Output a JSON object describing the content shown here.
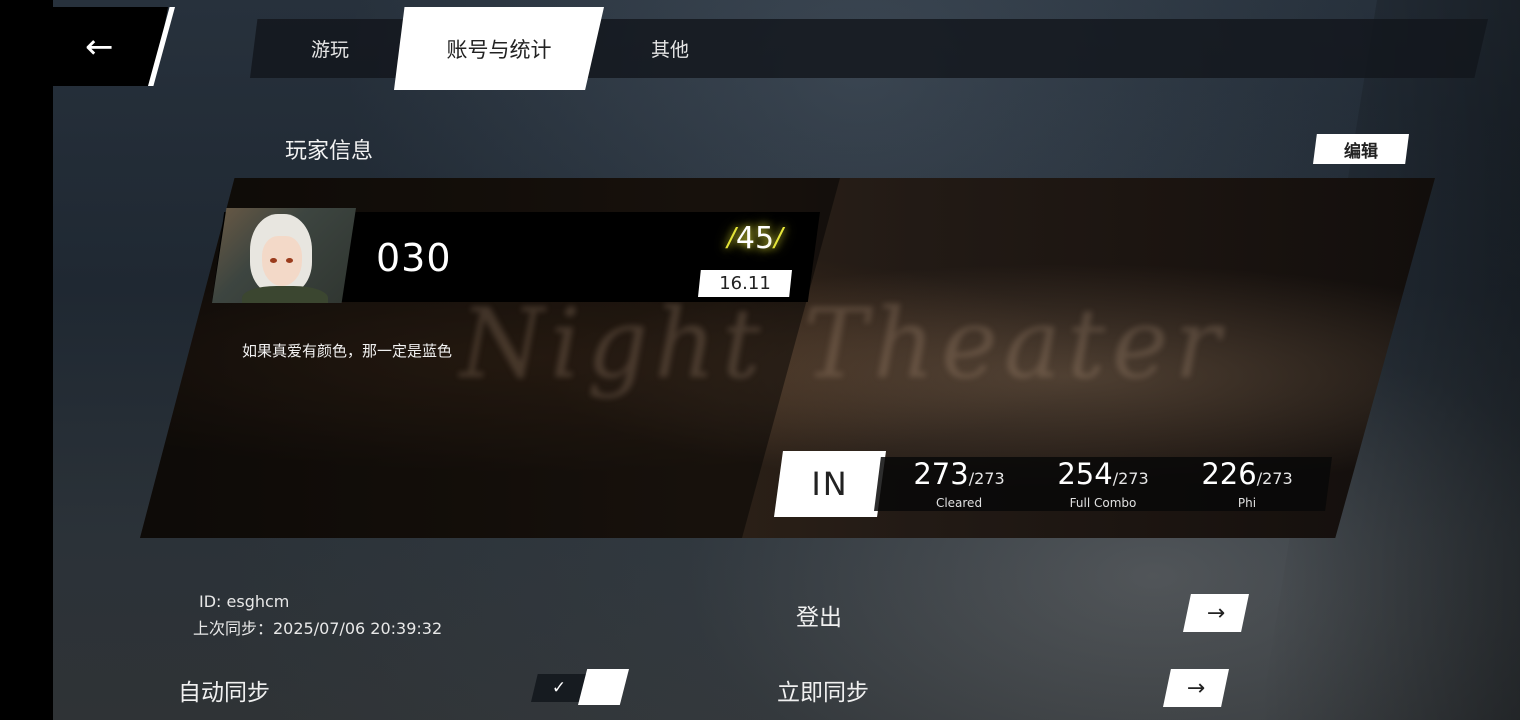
{
  "back_button": {
    "icon": "arrow-left-icon",
    "glyph": "←"
  },
  "tabs": [
    {
      "label": "游玩",
      "active": false
    },
    {
      "label": "账号与统计",
      "active": true
    },
    {
      "label": "其他",
      "active": false
    }
  ],
  "section": {
    "title": "玩家信息",
    "edit_label": "编辑"
  },
  "player": {
    "name": "030",
    "level": "45",
    "rks": "16.11",
    "motto": "如果真爱有颜色，那一定是蓝色",
    "background_text": "Night Theater"
  },
  "stats": {
    "difficulty": "IN",
    "cleared": {
      "value": "273",
      "total": "/273",
      "label": "Cleared"
    },
    "full_combo": {
      "value": "254",
      "total": "/273",
      "label": "Full Combo"
    },
    "phi": {
      "value": "226",
      "total": "/273",
      "label": "Phi"
    }
  },
  "account": {
    "id_line": "ID: esghcm",
    "last_sync_line": "上次同步：2025/07/06 20:39:32",
    "logout_label": "登出",
    "auto_sync_label": "自动同步",
    "auto_sync_enabled": true,
    "check_glyph": "✓",
    "sync_now_label": "立即同步",
    "arrow_glyph": "→"
  },
  "colors": {
    "accent_level": "#e6e63a",
    "panel_dark": "#000000",
    "active_tab": "#ffffff"
  }
}
